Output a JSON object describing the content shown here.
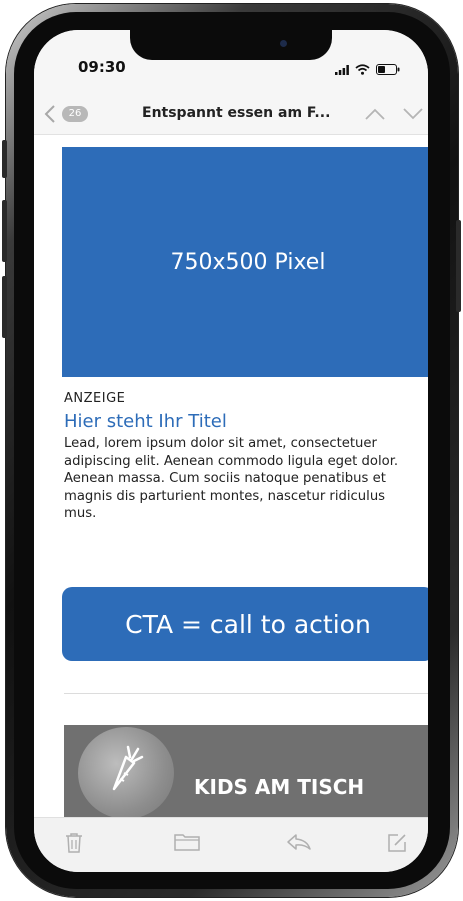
{
  "status_bar": {
    "time": "09:30"
  },
  "nav": {
    "unread_count": "26",
    "subject": "Entspannt essen am F..."
  },
  "email": {
    "hero_label": "750x500 Pixel",
    "ad_label": "ANZEIGE",
    "ad_title": "Hier steht Ihr Titel",
    "ad_body": "Lead, lorem ipsum dolor sit amet, consectetuer adipiscing elit. Aenean commodo ligula eget dolor. Aenean massa. Cum sociis natoque penatibus et magnis dis parturient montes, nascetur ridiculus mus.",
    "cta_label": "CTA = call to action",
    "next_teaser_title": "KIDS AM TISCH"
  },
  "toolbar": {
    "icons": [
      "trash-icon",
      "folder-icon",
      "reply-icon",
      "compose-icon"
    ]
  },
  "colors": {
    "accent": "#2d6cb8",
    "teaser_bg": "#707070",
    "screen_bg": "#f6f6f6"
  }
}
